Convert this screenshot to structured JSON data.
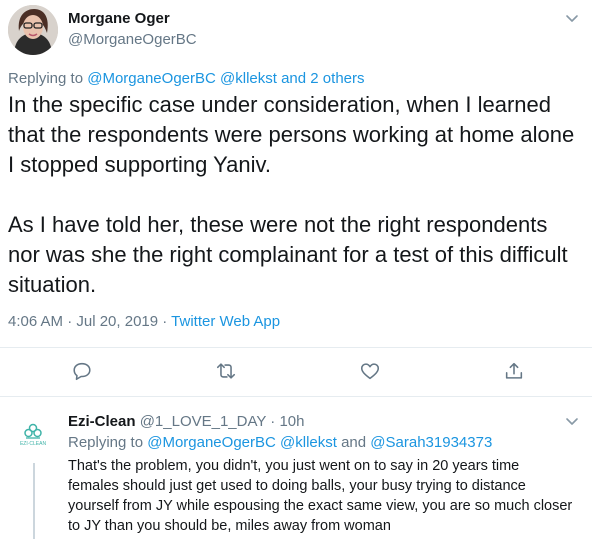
{
  "tweet": {
    "author_name": "Morgane Oger",
    "author_handle": "@MorganeOgerBC",
    "replying_prefix": "Replying to ",
    "replying_to": "@MorganeOgerBC",
    "replying_mid": " @kllekst",
    "replying_and": " and ",
    "replying_others": "2 others",
    "text_p1": "In the specific case under consideration, when I learned that the respondents were persons working at home alone I stopped supporting Yaniv.",
    "text_p2": "As I have told her, these were not the right respondents nor was she the right complainant for a test of this difficult situation.",
    "timestamp": "4:06 AM · Jul 20, 2019",
    "separator": " · ",
    "source": "Twitter Web App",
    "actions": [
      "reply-icon",
      "retweet-icon",
      "like-icon",
      "share-icon"
    ]
  },
  "reply": {
    "author_name": "Ezi-Clean",
    "author_handle": "@1_LOVE_1_DAY",
    "time": " · 10h",
    "avatar_text": "EZI·CLEAN",
    "replying_prefix": "Replying to ",
    "replying_to_1": "@MorganeOgerBC",
    "replying_to_2": " @kllekst",
    "replying_and": " and ",
    "replying_to_3": "@Sarah31934373",
    "text": "That's the problem, you didn't, you just went on to say in 20 years time females should just get used to doing balls, your busy trying to distance yourself from JY while espousing the exact same view, you are so much closer to JY than you should be, miles away from woman"
  },
  "colors": {
    "accent": "#1b95e0",
    "secondary_text": "#657786",
    "primary_text": "#14171a",
    "divider": "#e6ecf0"
  }
}
